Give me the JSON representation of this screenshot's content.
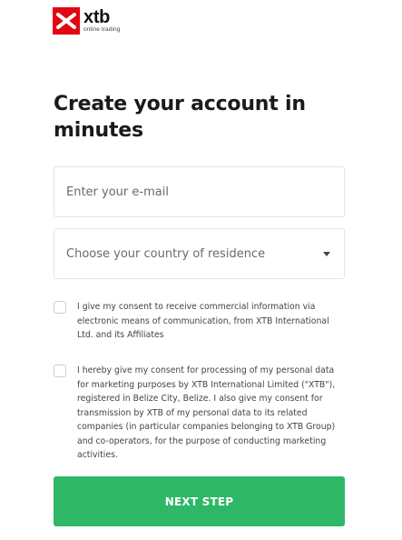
{
  "brand": {
    "name": "xtb",
    "tagline": "online trading",
    "icon": "xtb-logo-icon",
    "color": "#e30613"
  },
  "page_title": "Create your account in minutes",
  "form": {
    "email": {
      "placeholder": "Enter your e-mail",
      "value": ""
    },
    "country": {
      "placeholder": "Choose your country of residence",
      "icon": "chevron-down-icon"
    },
    "consents": [
      {
        "checked": false,
        "text": "I give my consent to receive commercial information via electronic means of communication, from XTB International Ltd. and its Affiliates"
      },
      {
        "checked": false,
        "text": "I hereby give my consent for processing of my personal data for marketing purposes by XTB International Limited (\"XTB\"), registered in Belize City, Belize. I also give my consent for transmission by XTB of my personal data to its related companies (in particular companies belonging to XTB Group) and co-operators, for the purpose of conducting marketing activities."
      }
    ],
    "submit_label": "NEXT STEP",
    "submit_color": "#2db766"
  }
}
